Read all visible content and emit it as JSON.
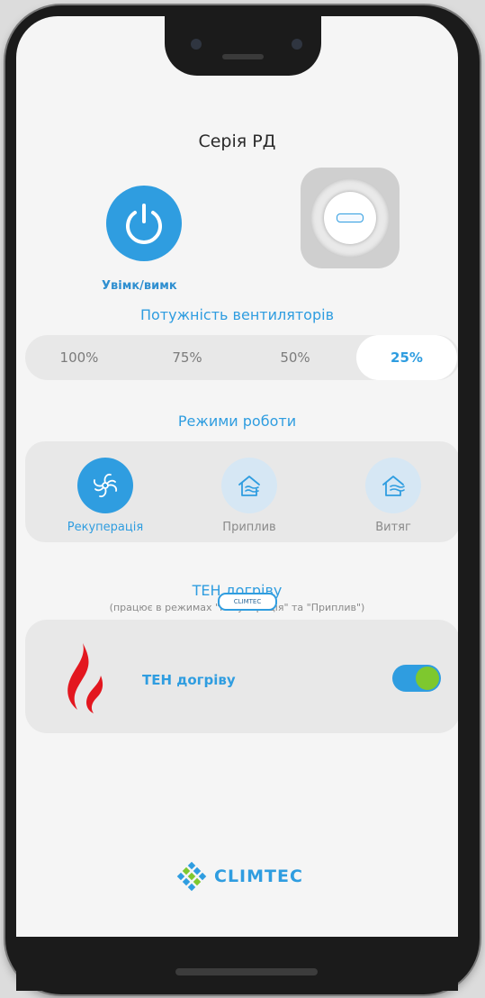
{
  "header": {
    "title": "Серія РД"
  },
  "power": {
    "label": "Увімк/вимк",
    "icon": "power-icon"
  },
  "device": {
    "icon": "ventilation-unit-image"
  },
  "fan": {
    "title": "Потужність вентиляторів",
    "options": [
      "100%",
      "75%",
      "50%",
      "25%"
    ],
    "selected": "25%"
  },
  "modes": {
    "title": "Режими роботи",
    "items": [
      {
        "label": "Рекуперація",
        "icon": "recuperation-fan-icon",
        "active": true
      },
      {
        "label": "Приплив",
        "icon": "supply-air-house-icon",
        "active": false
      },
      {
        "label": "Витяг",
        "icon": "exhaust-air-house-icon",
        "active": false
      }
    ]
  },
  "heater": {
    "title": "ТЕН догріву",
    "note": "(працює в режимах \"Рекуперація\" та \"Приплив\")",
    "label": "ТЕН догріву",
    "enabled": true,
    "icon": "flame-icon"
  },
  "watermark": {
    "text": "CLIMTEC"
  },
  "footer": {
    "logo_text": "CLIMTEC"
  },
  "colors": {
    "accent": "#2f9de0",
    "toggle_knob": "#7ec82e",
    "flame": "#e3171f"
  }
}
